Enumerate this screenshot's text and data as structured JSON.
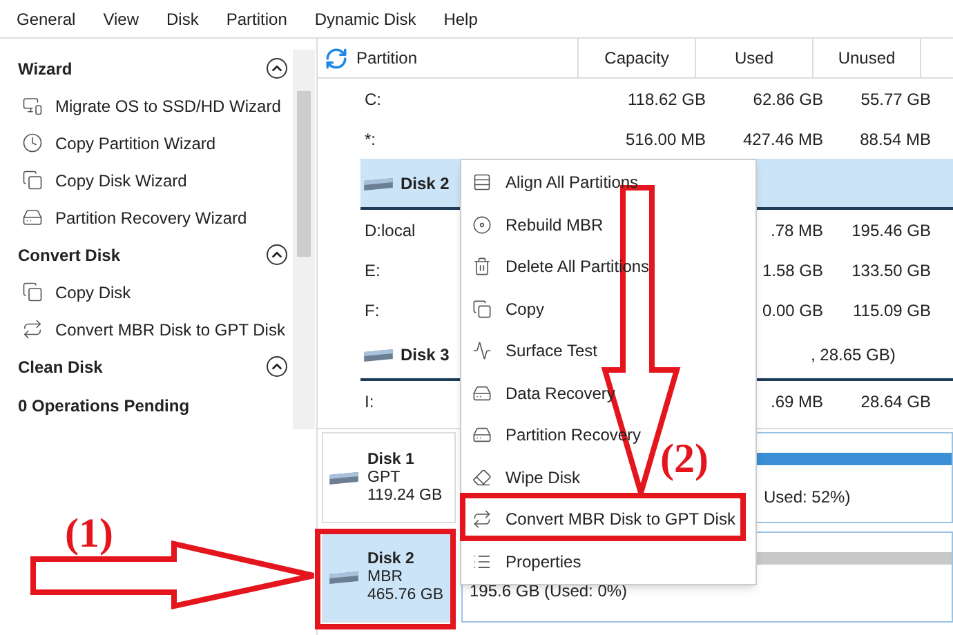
{
  "menu_bar": [
    "General",
    "View",
    "Disk",
    "Partition",
    "Dynamic Disk",
    "Help"
  ],
  "sidebar": {
    "sections": [
      {
        "title": "Wizard",
        "expanded": true,
        "items": [
          "Migrate OS to SSD/HD Wizard",
          "Copy Partition Wizard",
          "Copy Disk Wizard",
          "Partition Recovery Wizard"
        ]
      },
      {
        "title": "Convert Disk",
        "expanded": true,
        "items": [
          "Copy Disk",
          "Convert MBR Disk to GPT Disk"
        ]
      },
      {
        "title": "Clean Disk",
        "expanded": true
      }
    ],
    "pending": "0 Operations Pending"
  },
  "table": {
    "columns": [
      "Partition",
      "Capacity",
      "Used",
      "Unused"
    ],
    "rows": [
      {
        "kind": "partition",
        "cells": [
          "C:",
          "118.62 GB",
          "62.86 GB",
          "55.77 GB"
        ]
      },
      {
        "kind": "partition",
        "cells": [
          "*:",
          "516.00 MB",
          "427.46 MB",
          "88.54 MB"
        ]
      },
      {
        "kind": "disk",
        "selected": true,
        "name": "Disk 2"
      },
      {
        "kind": "partition",
        "cells": [
          "D:local",
          "",
          ".78 MB",
          "195.46 GB"
        ]
      },
      {
        "kind": "partition",
        "cells": [
          "E:",
          "",
          "1.58 GB",
          "133.50 GB"
        ]
      },
      {
        "kind": "partition",
        "cells": [
          "F:",
          "",
          "0.00 GB",
          "115.09 GB"
        ]
      },
      {
        "kind": "disk",
        "selected": false,
        "name": "Disk 3",
        "info": ", 28.65 GB)"
      },
      {
        "kind": "partition",
        "cells": [
          "I:",
          "",
          ".69 MB",
          "28.64 GB"
        ]
      }
    ]
  },
  "disk_map": [
    {
      "name": "Disk 1",
      "style": "GPT",
      "size": "119.24 GB",
      "selected": false,
      "color": "#3a8fd6",
      "usage": "Used: 52%)"
    },
    {
      "name": "Disk 2",
      "style": "MBR",
      "size": "465.76 GB",
      "selected": true,
      "color": "#c8c8c8",
      "usage": "195.6 GB (Used: 0%)"
    }
  ],
  "context_menu": [
    "Align All Partitions",
    "Rebuild MBR",
    "Delete All Partitions",
    "Copy",
    "Surface Test",
    "Data Recovery",
    "Partition Recovery",
    "Wipe Disk",
    "Convert MBR Disk to GPT Disk",
    "Properties"
  ],
  "annotations": [
    {
      "label": "(1)"
    },
    {
      "label": "(2)"
    }
  ]
}
